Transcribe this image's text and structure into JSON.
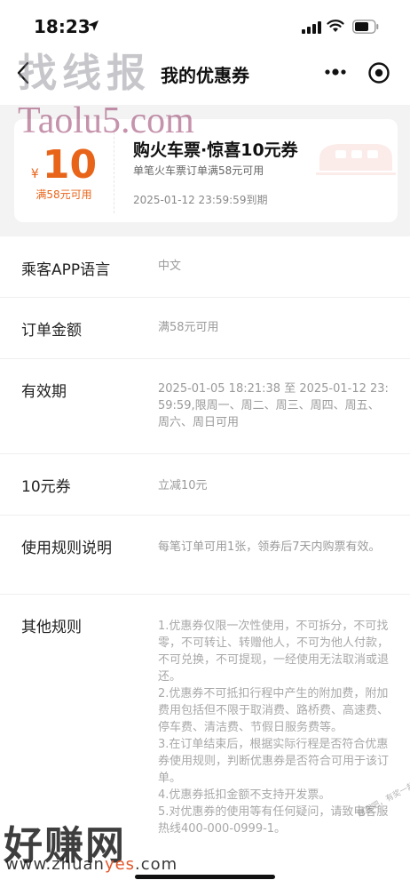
{
  "status_bar": {
    "time": "18:23"
  },
  "nav": {
    "title": "我的优惠券"
  },
  "watermarks": {
    "top_cn": "找线报",
    "top_en": "Taolu5.com",
    "bottom_cn": "好赚网",
    "bottom_url_pre": "www.zhuan",
    "bottom_url_hl": "yes",
    "bottom_url_post": ".com",
    "side_stamp": "赚客吧，有奖一起赚！ www.zuanke8.com"
  },
  "coupon": {
    "currency": "¥",
    "amount": "10",
    "threshold": "满58元可用",
    "title": "购火车票·惊喜10元券",
    "condition": "单笔火车票订单满58元可用",
    "expire": "2025-01-12 23:59:59到期"
  },
  "details": [
    {
      "label": "乘客APP语言",
      "value": "中文"
    },
    {
      "label": "订单金额",
      "value": "满58元可用"
    },
    {
      "label": "有效期",
      "value": "2025-01-05 18:21:38 至 2025-01-12 23:59:59,限周一、周二、周三、周四、周五、周六、周日可用"
    },
    {
      "label": "10元券",
      "value": "立减10元"
    },
    {
      "label": "使用规则说明",
      "value": "每笔订单可用1张，领券后7天内购票有效。"
    },
    {
      "label": "其他规则",
      "value": "1.优惠券仅限一次性使用，不可拆分，不可找零，不可转让、转赠他人，不可为他人付款，不可兑换，不可提现，一经使用无法取消或退还。\n2.优惠券不可抵扣行程中产生的附加费，附加费用包括但不限于取消费、路桥费、高速费、停车费、清洁费、节假日服务费等。\n3.在订单结束后，根据实际行程是否符合优惠券使用规则，判断优惠券是否符合可用于该订单。\n4.优惠券抵扣金额不支持开发票。\n5.对优惠券的使用等有任何疑问，请致电客服热线400-000-0999-1。"
    }
  ]
}
